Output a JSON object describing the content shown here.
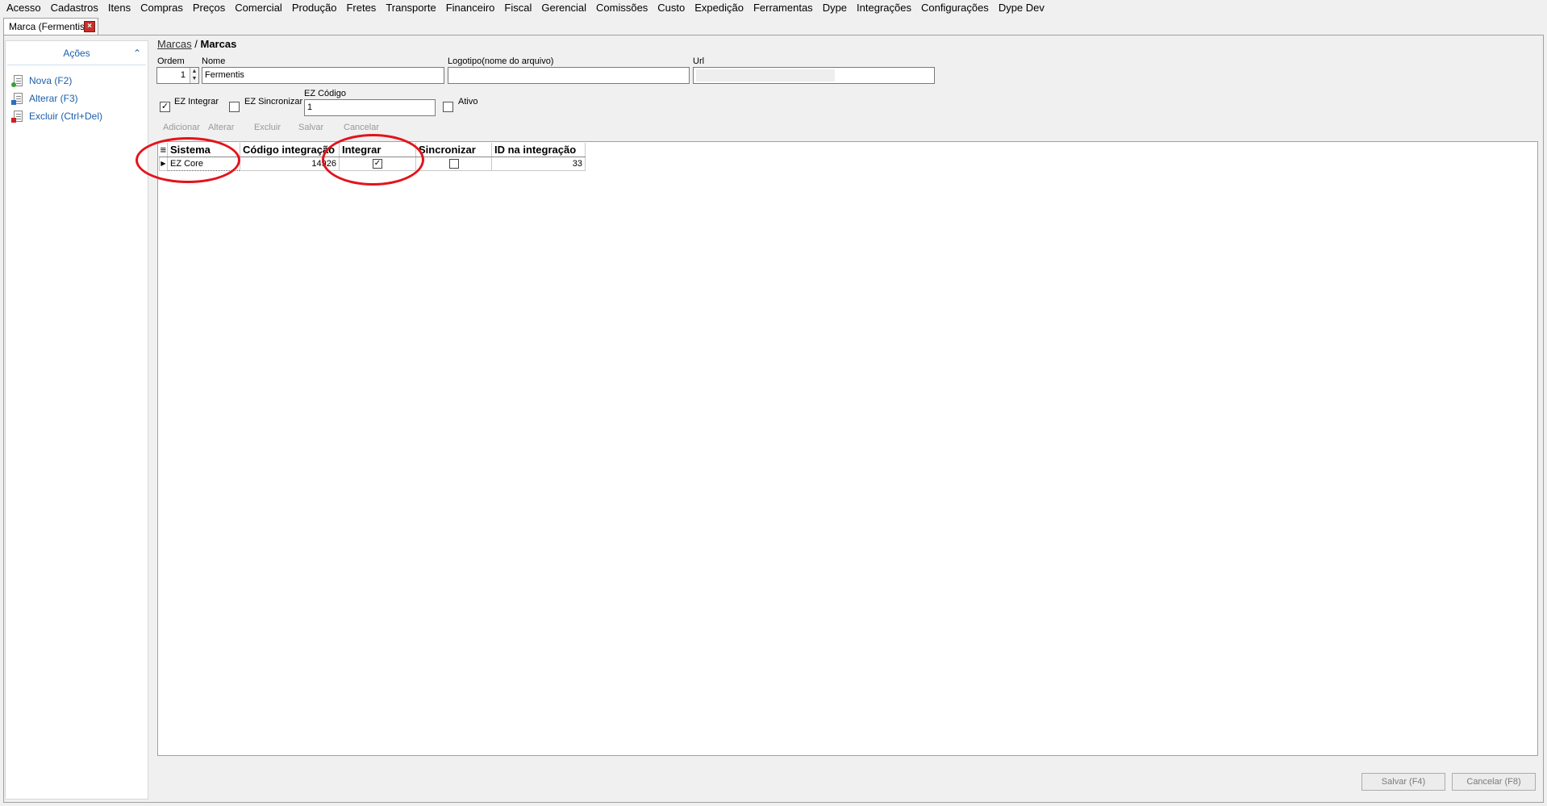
{
  "menu": [
    "Acesso",
    "Cadastros",
    "Itens",
    "Compras",
    "Preços",
    "Comercial",
    "Produção",
    "Fretes",
    "Transporte",
    "Financeiro",
    "Fiscal",
    "Gerencial",
    "Comissões",
    "Custo",
    "Expedição",
    "Ferramentas",
    "Dype",
    "Integrações",
    "Configurações",
    "Dype Dev"
  ],
  "tab": {
    "title": "Marca (Fermentis)",
    "close": "×"
  },
  "sidebar": {
    "header": "Ações",
    "collapse": "⌃",
    "actions": [
      {
        "label": "Nova (F2)",
        "icon": "new-document-icon"
      },
      {
        "label": "Alterar (F3)",
        "icon": "edit-document-icon"
      },
      {
        "label": "Excluir (Ctrl+Del)",
        "icon": "delete-document-icon"
      }
    ]
  },
  "breadcrumb": {
    "parent": "Marcas",
    "sep": "/",
    "current": "Marcas"
  },
  "form": {
    "ordem_label": "Ordem",
    "ordem_value": "1",
    "nome_label": "Nome",
    "nome_value": "Fermentis",
    "logotipo_label": "Logotipo(nome do arquivo)",
    "logotipo_value": "",
    "url_label": "Url",
    "url_value": "",
    "ez_integrar_label": "EZ Integrar",
    "ez_integrar_checked": true,
    "ez_sincronizar_label": "EZ Sincronizar",
    "ez_sincronizar_checked": false,
    "ez_codigo_label": "EZ Código",
    "ez_codigo_value": "1",
    "ativo_label": "Ativo",
    "ativo_checked": false
  },
  "grid_toolbar": [
    "Adicionar",
    "Alterar",
    "Excluir",
    "Salvar",
    "Cancelar"
  ],
  "grid": {
    "columns": [
      "Sistema",
      "Código integração",
      "Integrar",
      "Sincronizar",
      "ID na integração"
    ],
    "rows": [
      {
        "sistema": "EZ Core",
        "codigo": "14926",
        "integrar": true,
        "sincronizar": false,
        "id": "33"
      }
    ]
  },
  "footer": {
    "save": "Salvar (F4)",
    "cancel": "Cancelar (F8)"
  },
  "colors": {
    "accent": "#1a5fa8",
    "annotation": "#e3131b",
    "close": "#c9302c"
  }
}
